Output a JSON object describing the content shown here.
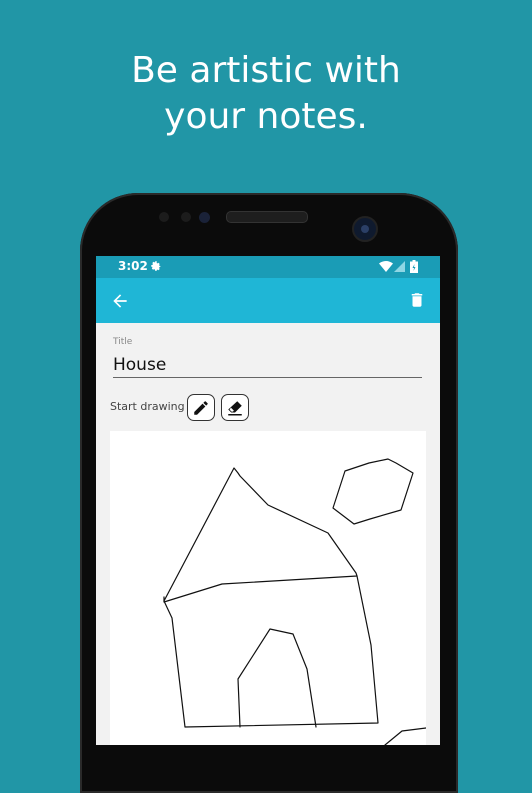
{
  "headline": {
    "line1": "Be artistic with",
    "line2": "your notes."
  },
  "status_bar": {
    "time": "3:02",
    "icons": [
      "gear-icon",
      "wifi-icon",
      "signal-icon",
      "battery-icon"
    ]
  },
  "toolbar": {
    "back_icon": "arrow-back-icon",
    "delete_icon": "trash-icon",
    "color": "#1FB6D6"
  },
  "form": {
    "title_label": "Title",
    "title_value": "House",
    "draw_label": "Start drawing",
    "tools": [
      "pencil-icon",
      "eraser-icon"
    ]
  },
  "colors": {
    "background": "#2196A6",
    "status_bar": "#1A9CB6",
    "app_bar": "#1FB6D6"
  }
}
